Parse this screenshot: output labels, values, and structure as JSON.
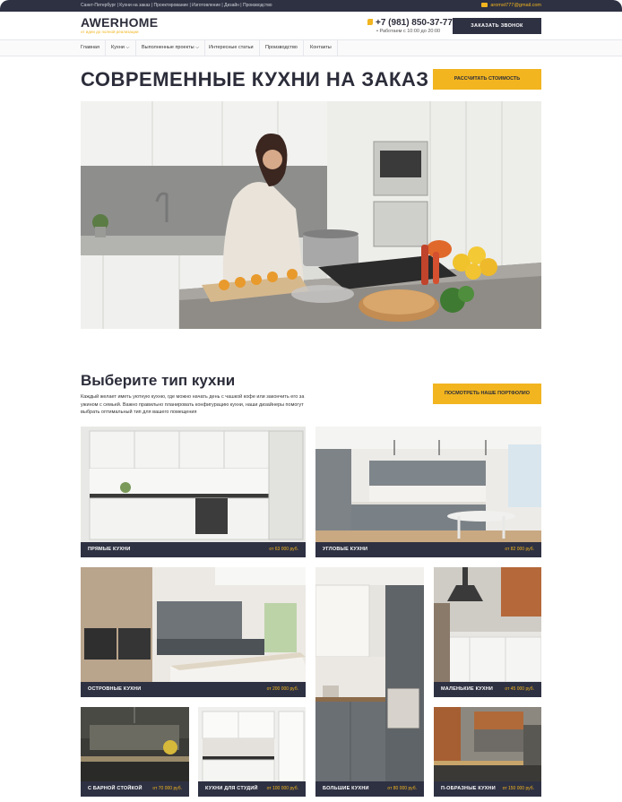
{
  "topbar": {
    "breadcrumbs": "Санкт-Петербург | Кухни на заказ | Проектирование | Изготовление | Дизайн | Производство",
    "email": "aromst777@gmail.com"
  },
  "header": {
    "logo": "AWERHOME",
    "tagline": "от идеи до полной реализации",
    "phone": "+7 (981) 850-37-77",
    "hours": "• Работаем с 10:00 до 20:00",
    "call_button": "ЗАКАЗАТЬ ЗВОНОК"
  },
  "nav": {
    "items": [
      {
        "label": "Главная"
      },
      {
        "label": "Кухни ⌵"
      },
      {
        "label": "Выполненные проекты ⌵"
      },
      {
        "label": "Интересные статьи"
      },
      {
        "label": "Производство"
      },
      {
        "label": "Контакты"
      }
    ]
  },
  "hero": {
    "title": "СОВРЕМЕННЫЕ КУХНИ НА ЗАКАЗ",
    "calc_button": "РАССЧИТАТЬ СТОИМОСТЬ"
  },
  "types": {
    "title": "Выберите тип кухни",
    "description": "Каждый желает иметь уютную кухню, где можно начать день с чашкой кофе или закончить его за ужином с семьей. Важно правильно планировать конфигурацию кухни, наши дизайнеры помогут выбрать оптимальный тип для вашего помещения",
    "portfolio_button": "ПОСМОТРЕТЬ НАШЕ ПОРТФОЛИО",
    "cards": [
      {
        "name": "ПРЯМЫЕ КУХНИ",
        "price": "от 63 000 руб."
      },
      {
        "name": "УГЛОВЫЕ КУХНИ",
        "price": "от 82 000 руб."
      },
      {
        "name": "ОСТРОВНЫЕ КУХНИ",
        "price": "от 200 000 руб."
      },
      {
        "name": "МАЛЕНЬКИЕ КУХНИ",
        "price": "от 45 000 руб."
      },
      {
        "name": "С БАРНОЙ СТОЙКОЙ",
        "price": "от 70 000 руб."
      },
      {
        "name": "КУХНИ ДЛЯ СТУДИЙ",
        "price": "от 100 000 руб."
      },
      {
        "name": "БОЛЬШИЕ КУХНИ",
        "price": "от 80 000 руб."
      },
      {
        "name": "П-ОБРАЗНЫЕ КУХНИ",
        "price": "от 150 000 руб."
      }
    ]
  },
  "colors": {
    "accent": "#f2b51f",
    "dark": "#2e3142",
    "text": "#2c2d3a"
  }
}
